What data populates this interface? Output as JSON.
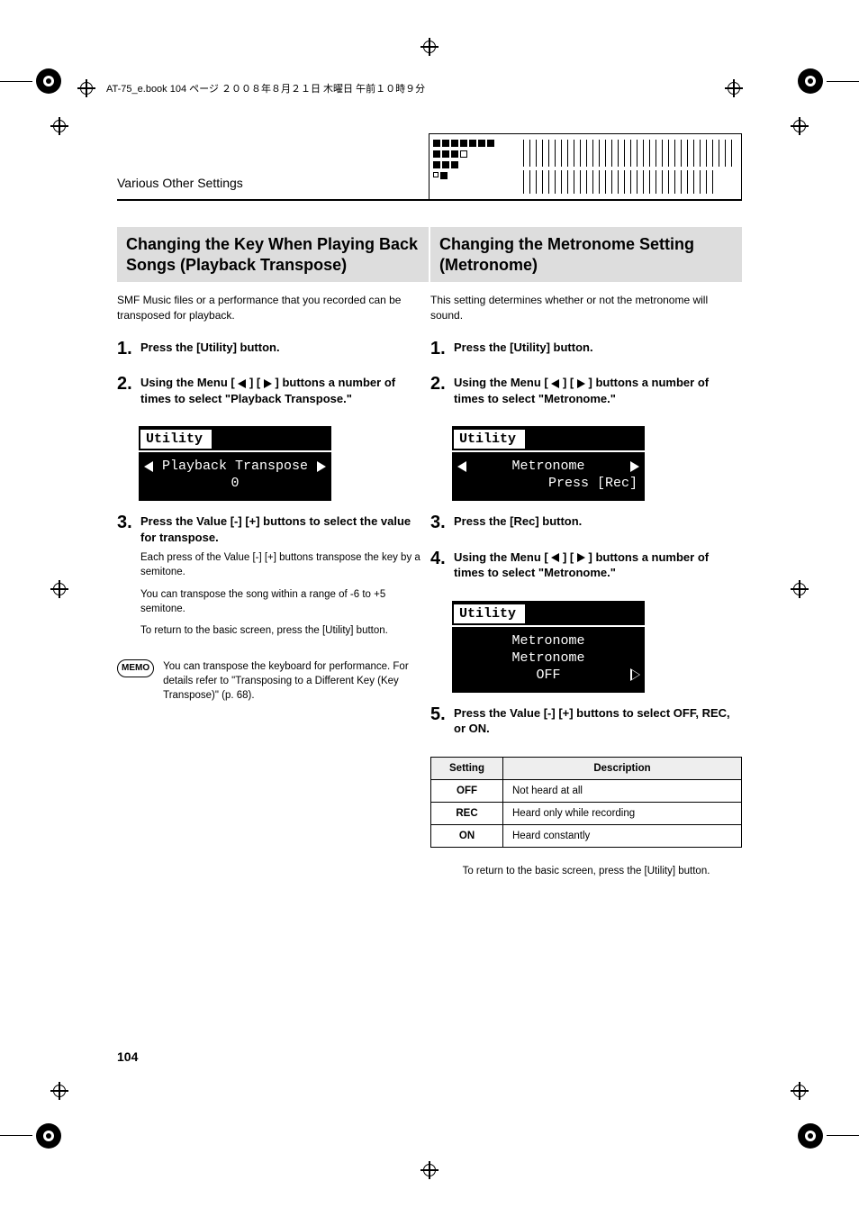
{
  "header": {
    "text": "AT-75_e.book 104 ページ ２００８年８月２１日 木曜日 午前１０時９分"
  },
  "section_label": "Various Other Settings",
  "page_number": "104",
  "left": {
    "title": "Changing the Key When Playing Back Songs (Playback Transpose)",
    "intro": "SMF Music files or a performance that you recorded can be transposed for playback.",
    "steps": {
      "s1": {
        "num": "1.",
        "head": "Press the [Utility] button."
      },
      "s2": {
        "num": "2.",
        "head_a": "Using the Menu [",
        "head_b": "] [",
        "head_c": "] buttons a number of times to select \"Playback Transpose.\""
      },
      "lcd1": {
        "title": "Utility",
        "line1": "Playback Transpose",
        "line2": "0"
      },
      "s3": {
        "num": "3.",
        "head": "Press the Value [-] [+] buttons to select the value for transpose.",
        "note1": "Each press of the Value [-] [+] buttons transpose the key by a semitone.",
        "note2": "You can transpose the song within a range of -6 to +5 semitone.",
        "note3": "To return to the basic screen, press the [Utility] button."
      }
    },
    "memo": {
      "label": "MEMO",
      "text": "You can transpose the keyboard for performance. For details refer to \"Transposing to a Different Key (Key Transpose)\" (p. 68)."
    }
  },
  "right": {
    "title": "Changing the Metronome Setting (Metronome)",
    "intro": "This setting determines whether or not the metronome will sound.",
    "steps": {
      "s1": {
        "num": "1.",
        "head": "Press the [Utility] button."
      },
      "s2": {
        "num": "2.",
        "head_a": "Using the Menu [",
        "head_b": "] [",
        "head_c": "] buttons a number of times to select \"Metronome.\""
      },
      "lcd1": {
        "title": "Utility",
        "line1": "Metronome",
        "line2": "Press [Rec]"
      },
      "s3": {
        "num": "3.",
        "head": "Press the [Rec] button."
      },
      "s4": {
        "num": "4.",
        "head_a": "Using the Menu [",
        "head_b": "] [",
        "head_c": "] buttons a number of times to select \"Metronome.\""
      },
      "lcd2": {
        "title": "Utility",
        "line1": "Metronome",
        "line2": "Metronome",
        "line3": "OFF"
      },
      "s5": {
        "num": "5.",
        "head": "Press the Value [-] [+] buttons to select OFF, REC, or ON."
      }
    },
    "table": {
      "h1": "Setting",
      "h2": "Description",
      "rows": [
        {
          "k": "OFF",
          "v": "Not heard at all"
        },
        {
          "k": "REC",
          "v": "Heard only while recording"
        },
        {
          "k": "ON",
          "v": "Heard constantly"
        }
      ]
    },
    "return_note": "To return to the basic screen, press the [Utility] button."
  }
}
